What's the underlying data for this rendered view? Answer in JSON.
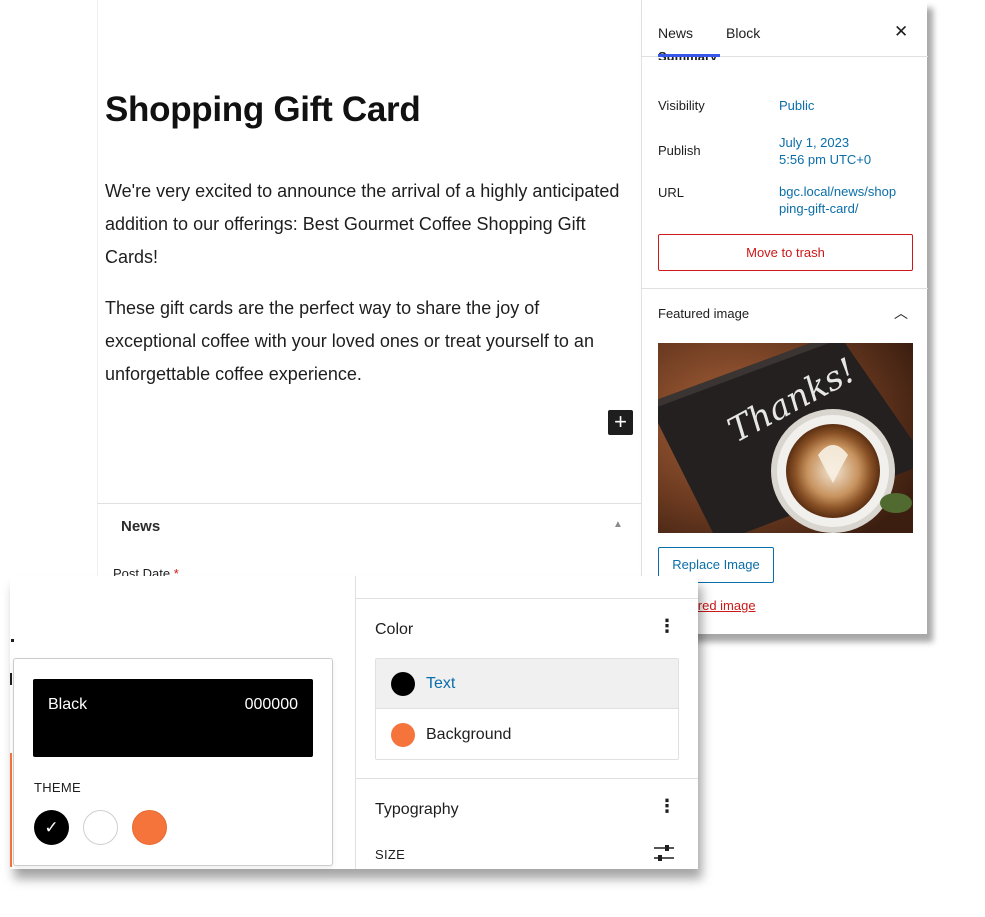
{
  "editor": {
    "title": "Shopping Gift Card",
    "paragraphs": [
      "We're very excited to announce the arrival of a highly anticipated addition to our offerings: Best Gourmet Coffee Shopping Gift Cards!",
      "These gift cards are the perfect way to share the joy of exceptional coffee with your loved ones or treat yourself to an unforgettable coffee experience."
    ],
    "add_block_icon": "plus-icon",
    "meta_box": {
      "title": "News",
      "toggle_icon": "triangle-up-icon",
      "post_date_label": "Post Date",
      "required_mark": "*"
    }
  },
  "sidebar": {
    "tabs": [
      "News",
      "Block"
    ],
    "close_icon": "close-icon",
    "summary_heading": "Summary",
    "visibility_label": "Visibility",
    "visibility_value": "Public",
    "publish_label": "Publish",
    "publish_date": "July 1, 2023",
    "publish_time": "5:56 pm UTC+0",
    "url_label": "URL",
    "url_line1": "bgc.local/news/shop",
    "url_line2": "ping-gift-card/",
    "trash_label": "Move to trash",
    "featured_title": "Featured image",
    "featured_chevron": "chevron-up-icon",
    "featured_image_text": "Thanks!",
    "replace_label": "Replace Image",
    "remove_label": "e featured image"
  },
  "color_popover": {
    "selected_name": "Black",
    "selected_hex": "000000",
    "theme_label": "THEME",
    "swatches": [
      {
        "name": "Black",
        "color": "#000000",
        "selected": true
      },
      {
        "name": "White",
        "color": "#ffffff",
        "selected": false
      },
      {
        "name": "Orange",
        "color": "#f5743c",
        "selected": false
      }
    ],
    "check_glyph": "✓"
  },
  "styles_panel": {
    "color_title": "Color",
    "options": [
      {
        "label": "Text",
        "color": "#000000",
        "active": true
      },
      {
        "label": "Background",
        "color": "#f5743c",
        "active": false
      }
    ],
    "typography_title": "Typography",
    "size_label": "SIZE",
    "menu_glyph": "⋮"
  },
  "colors": {
    "link_blue": "#0a6ea8",
    "danger_red": "#cc1818",
    "accent": "#f5743c"
  }
}
